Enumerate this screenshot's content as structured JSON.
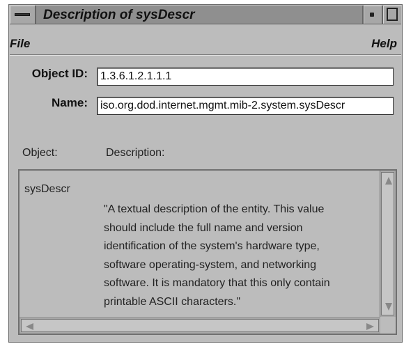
{
  "window": {
    "title": "Description of sysDescr"
  },
  "menubar": {
    "file_label": "File",
    "help_label": "Help"
  },
  "form": {
    "object_id_label": "Object ID:",
    "object_id_value": "1.3.6.1.2.1.1.1",
    "name_label": "Name:",
    "name_value": "iso.org.dod.internet.mgmt.mib-2.system.sysDescr"
  },
  "list": {
    "col_object": "Object:",
    "col_description": "Description:",
    "entries": [
      {
        "object": "sysDescr",
        "description": "\"A textual description of the entity.  This value\nshould include the full name and version\nidentification of the system's hardware type,\nsoftware operating-system, and networking\nsoftware.  It is mandatory that this only contain\nprintable ASCII characters.\""
      }
    ]
  },
  "icons": {
    "window_menu": "window-menu-icon",
    "minimize": "minimize-icon",
    "maximize": "maximize-icon",
    "scroll_up": "scroll-up-arrow-icon",
    "scroll_down": "scroll-down-arrow-icon",
    "scroll_left": "scroll-left-arrow-icon",
    "scroll_right": "scroll-right-arrow-icon"
  },
  "colors": {
    "window_bg": "#bcbcbc",
    "titlebar_bg": "#8f8f8f",
    "field_bg": "#ffffff"
  }
}
